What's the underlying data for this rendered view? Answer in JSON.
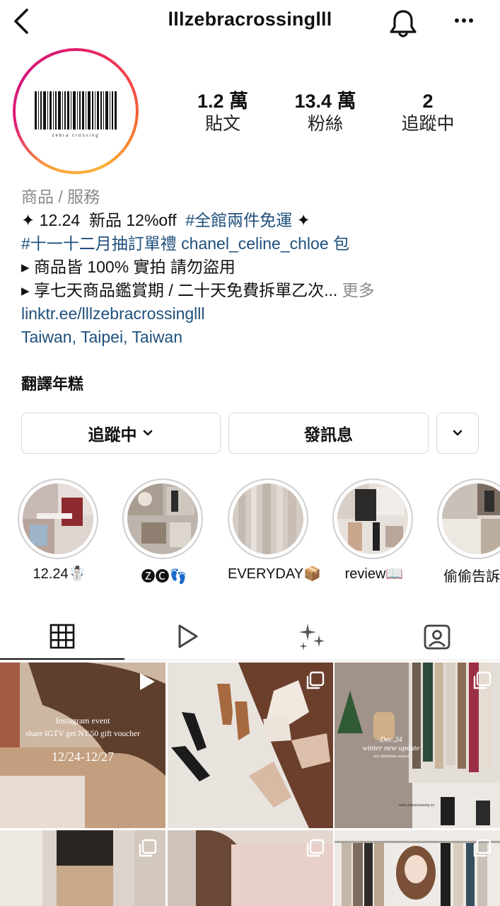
{
  "header": {
    "username": "lllzebracrossinglll",
    "back_icon": "chevron-left-icon",
    "bell_icon": "bell-icon",
    "more_icon": "more-horizontal-icon"
  },
  "avatar": {
    "logo_text": "zebra crossing",
    "ring_colors": [
      "#e01e6b",
      "#f76c34",
      "#fbb033"
    ]
  },
  "stats": [
    {
      "value": "1.2 萬",
      "label": "貼文"
    },
    {
      "value": "13.4 萬",
      "label": "粉絲"
    },
    {
      "value": "2",
      "label": "追蹤中"
    }
  ],
  "bio": {
    "category": "商品 / 服務",
    "line1_prefix": "✦ 12.24  新品 12%off  ",
    "line1_tag": "#全館兩件免運",
    "line1_suffix": " ✦",
    "line2": "#十一十二月抽訂單禮 chanel_celine_chloe 包",
    "line3": "▸ 商品皆 100% 實拍 請勿盜用",
    "line4": "▸ 享七天商品鑑賞期 / 二十天免費拆單乙次...",
    "more": " 更多",
    "link": "linktr.ee/lllzebracrossinglll",
    "location": "Taiwan, Taipei, Taiwan",
    "translate": "翻譯年糕"
  },
  "buttons": {
    "following": "追蹤中",
    "message": "發訊息"
  },
  "highlights": [
    {
      "label": "12.24☃️"
    },
    {
      "label": "🅩🅒👣"
    },
    {
      "label": "EVERYDAY📦"
    },
    {
      "label": "review📖"
    },
    {
      "label": "偷偷告訴妳"
    }
  ],
  "tabs": [
    {
      "name": "grid-icon"
    },
    {
      "name": "reels-icon"
    },
    {
      "name": "sparkles-icon"
    },
    {
      "name": "tagged-icon"
    }
  ],
  "posts": [
    {
      "line1": "Instagram event",
      "line2": "share IGTV get NT.50 gift voucher",
      "line3": "12/24-12/27"
    },
    {},
    {
      "line1": "Dec.24",
      "line2": "winter new update",
      "line3": "our christmas season",
      "line4": "www.zebracrossing.co"
    }
  ]
}
